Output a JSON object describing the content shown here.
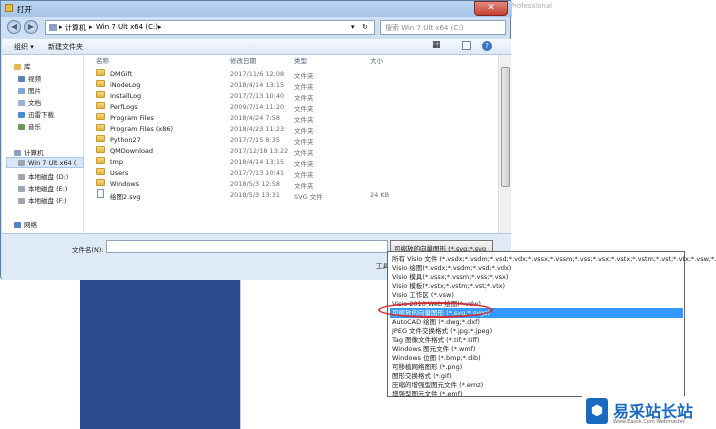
{
  "background": {
    "corner_text": "Professional"
  },
  "dialog": {
    "title": "打开",
    "close": "✕",
    "breadcrumb": [
      "计算机",
      "Win 7 Ult x64 (C:)"
    ],
    "search_placeholder": "搜索 Win 7 Ult x64 (C:)",
    "toolbar": {
      "organize": "组织 ▾",
      "new_folder": "新建文件夹"
    },
    "sidebar": [
      {
        "label": "库",
        "color": "#e8b84a"
      },
      {
        "label": "视频",
        "color": "#5a7fbf"
      },
      {
        "label": "图片",
        "color": "#7fa6d8"
      },
      {
        "label": "文档",
        "color": "#9cb3d6"
      },
      {
        "label": "迅雷下载",
        "color": "#3f8fd8"
      },
      {
        "label": "音乐",
        "color": "#6b9b4f"
      },
      {
        "label": "计算机",
        "color": "#8aa2c2"
      },
      {
        "label": "Win 7 Ult x64 (",
        "color": "#9aa6b6"
      },
      {
        "label": "本地磁盘 (D:)",
        "color": "#9aa6b6"
      },
      {
        "label": "本地磁盘 (E:)",
        "color": "#9aa6b6"
      },
      {
        "label": "本地磁盘 (F:)",
        "color": "#9aa6b6"
      },
      {
        "label": "网络",
        "color": "#4f84c6"
      }
    ],
    "columns": {
      "name": "名称",
      "modified": "修改日期",
      "type": "类型",
      "size": "大小"
    },
    "files": [
      {
        "name": "DMGift",
        "date": "2017/11/6 12:08",
        "type": "文件夹",
        "size": ""
      },
      {
        "name": "iNodeLog",
        "date": "2018/4/14 13:15",
        "type": "文件夹",
        "size": ""
      },
      {
        "name": "InstallLog",
        "date": "2017/7/13 10:40",
        "type": "文件夹",
        "size": ""
      },
      {
        "name": "PerfLogs",
        "date": "2009/7/14 11:20",
        "type": "文件夹",
        "size": ""
      },
      {
        "name": "Program Files",
        "date": "2018/4/24 7:58",
        "type": "文件夹",
        "size": ""
      },
      {
        "name": "Program Files (x86)",
        "date": "2018/4/23 11:23",
        "type": "文件夹",
        "size": ""
      },
      {
        "name": "Python27",
        "date": "2017/7/15 8:35",
        "type": "文件夹",
        "size": ""
      },
      {
        "name": "QMDownload",
        "date": "2017/12/18 13:22",
        "type": "文件夹",
        "size": ""
      },
      {
        "name": "tmp",
        "date": "2018/4/14 13:15",
        "type": "文件夹",
        "size": ""
      },
      {
        "name": "Users",
        "date": "2017/7/13 10:41",
        "type": "文件夹",
        "size": ""
      },
      {
        "name": "Windows",
        "date": "2018/5/3 12:58",
        "type": "文件夹",
        "size": ""
      },
      {
        "name": "绘图2.svg",
        "date": "2018/5/3 13:31",
        "type": "SVG 文件",
        "size": "24 KB"
      }
    ],
    "filename_label": "文件名(N):",
    "filetype_selected": "可缩放的向量图形 (*.svg;*.svg ▾",
    "tools_label": "工具(L) ▾"
  },
  "dropdown": {
    "selected_index": 6,
    "options": [
      "所有 Visio 文件 (*.vsdx;*.vsdm;*.vsd;*.vdx;*.vssx;*.vssm;*.vss;*.vsx;*.vstx;*.vstm;*.vst;*.vtx;*.vsw;*.vdw)",
      "Visio 绘图(*.vsdx;*.vsdm;*.vsd;*.vdx)",
      "Visio 模具(*.vssx;*.vssm;*.vss;*.vsx)",
      "Visio 模板(*.vstx;*.vstm;*.vst;*.vtx)",
      "Visio 工作区 (*.vsw)",
      "Visio 2010 Web 绘图(*.vdw)",
      "可缩放的向量图形 (*.svg;*.svgz)",
      "AutoCAD 绘图 (*.dwg;*.dxf)",
      "JPEG 文件交换格式 (*.jpg;*.jpeg)",
      "Tag 图像文件格式 (*.tif;*.tiff)",
      "Windows 图元文件 (*.wmf)",
      "Windows 位图 (*.bmp;*.dib)",
      "可移植网络图形 (*.png)",
      "图形交换格式 (*.gif)",
      "压缩的增强型图元文件 (*.emz)",
      "增强型图元文件 (*.emf)"
    ]
  },
  "logo": {
    "mark": "⬢",
    "text": "易采站长站",
    "subtitle": "Www.Easck.Com Webmaster"
  }
}
